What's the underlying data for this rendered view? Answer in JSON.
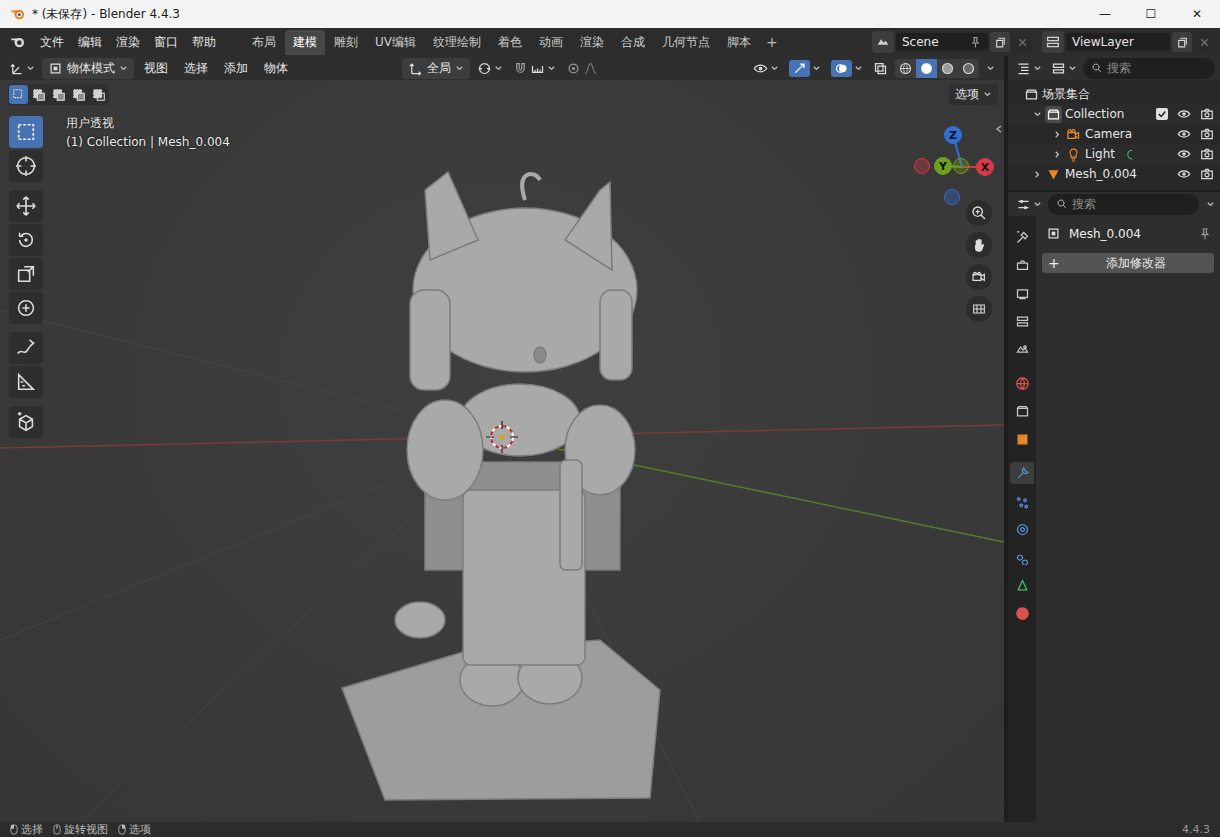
{
  "window": {
    "title": "* (未保存) - Blender 4.4.3",
    "controls": [
      "—",
      "☐",
      "✕"
    ]
  },
  "menu": [
    "文件",
    "编辑",
    "渲染",
    "窗口",
    "帮助"
  ],
  "workspaces": [
    {
      "label": "布局",
      "selected": false
    },
    {
      "label": "建模",
      "selected": true
    },
    {
      "label": "雕刻",
      "selected": false
    },
    {
      "label": "UV编辑",
      "selected": false
    },
    {
      "label": "纹理绘制",
      "selected": false
    },
    {
      "label": "着色",
      "selected": false
    },
    {
      "label": "动画",
      "selected": false
    },
    {
      "label": "渲染",
      "selected": false
    },
    {
      "label": "合成",
      "selected": false
    },
    {
      "label": "几何节点",
      "selected": false
    },
    {
      "label": "脚本",
      "selected": false
    }
  ],
  "add_workspace": "+",
  "scene": {
    "label": "Scene"
  },
  "view_layer": {
    "label": "ViewLayer"
  },
  "viewport": {
    "mode": "物体模式",
    "menus": [
      "视图",
      "选择",
      "添加",
      "物体"
    ],
    "transform": "全局",
    "options": "选项",
    "view_name": "用户透视",
    "object_info": "(1) Collection | Mesh_0.004",
    "select_modes": [
      {
        "name": "set",
        "selected": true
      },
      {
        "name": "extend",
        "selected": false
      },
      {
        "name": "subtract",
        "selected": false
      },
      {
        "name": "invert",
        "selected": false
      },
      {
        "name": "intersect",
        "selected": false
      }
    ],
    "shading": [
      {
        "name": "wireframe",
        "selected": false
      },
      {
        "name": "solid",
        "selected": true
      },
      {
        "name": "material",
        "selected": false
      },
      {
        "name": "rendered",
        "selected": false
      }
    ],
    "tools": [
      {
        "name": "select-box",
        "selected": true
      },
      {
        "name": "cursor",
        "selected": false
      },
      {
        "name": "move",
        "selected": false
      },
      {
        "name": "rotate",
        "selected": false
      },
      {
        "name": "scale",
        "selected": false
      },
      {
        "name": "transform",
        "selected": false
      },
      {
        "name": "annotate",
        "selected": false
      },
      {
        "name": "measure",
        "selected": false
      },
      {
        "name": "add-cube",
        "selected": false
      }
    ],
    "gizmo": [
      {
        "label": "Z",
        "kind": "positive",
        "color": "#2f6fd6"
      },
      {
        "label": "",
        "kind": "negative",
        "color": "#2f6fd6"
      },
      {
        "label": "X",
        "kind": "positive",
        "color": "#d63a48"
      },
      {
        "label": "",
        "kind": "negative",
        "color": "#d63a48"
      },
      {
        "label": "Y",
        "kind": "positive",
        "color": "#6fa01e"
      },
      {
        "label": "",
        "kind": "negative",
        "color": "#6fa01e"
      }
    ],
    "nav": [
      "zoom",
      "pan",
      "camera",
      "ortho"
    ]
  },
  "outliner": {
    "search_placeholder": "搜索",
    "root": "场景集合",
    "items": [
      {
        "label": "Collection",
        "kind": "collection",
        "expanded": true,
        "checked": true,
        "visible": true,
        "renderable": true,
        "children": [
          {
            "label": "Camera",
            "kind": "camera",
            "expanded": false,
            "visible": true,
            "renderable": true
          },
          {
            "label": "Light",
            "kind": "light",
            "expanded": false,
            "visible": true,
            "renderable": true
          }
        ]
      },
      {
        "label": "Mesh_0.004",
        "kind": "mesh",
        "expanded": false,
        "visible": true,
        "renderable": true
      }
    ]
  },
  "properties": {
    "search_placeholder": "搜索",
    "object": "Mesh_0.004",
    "add_modifier": "添加修改器",
    "add_icon": "+",
    "tabs": [
      {
        "name": "tool",
        "selected": false,
        "color": "#c8c8c8"
      },
      {
        "name": "render",
        "selected": false,
        "color": "#c8c8c8"
      },
      {
        "name": "output",
        "selected": false,
        "color": "#c8c8c8"
      },
      {
        "name": "view-layer",
        "selected": false,
        "color": "#c8c8c8"
      },
      {
        "name": "scene",
        "selected": false,
        "color": "#c8c8c8"
      },
      {
        "name": "world",
        "selected": false,
        "color": "#d9534f"
      },
      {
        "name": "collection",
        "selected": false,
        "color": "#c8c8c8"
      },
      {
        "name": "object",
        "selected": false,
        "color": "#e8862a"
      },
      {
        "name": "modifier",
        "selected": true,
        "color": "#5c8fe0"
      },
      {
        "name": "particles",
        "selected": false,
        "color": "#5c8fe0"
      },
      {
        "name": "physics",
        "selected": false,
        "color": "#5c8fe0"
      },
      {
        "name": "constraints",
        "selected": false,
        "color": "#5c8fe0"
      },
      {
        "name": "data",
        "selected": false,
        "color": "#3fbf6f"
      },
      {
        "name": "material",
        "selected": false,
        "color": "#d9534f"
      }
    ]
  },
  "status_bar": {
    "items": [
      "选择",
      "旋转视图",
      "选项"
    ],
    "version": "4.4.3"
  }
}
